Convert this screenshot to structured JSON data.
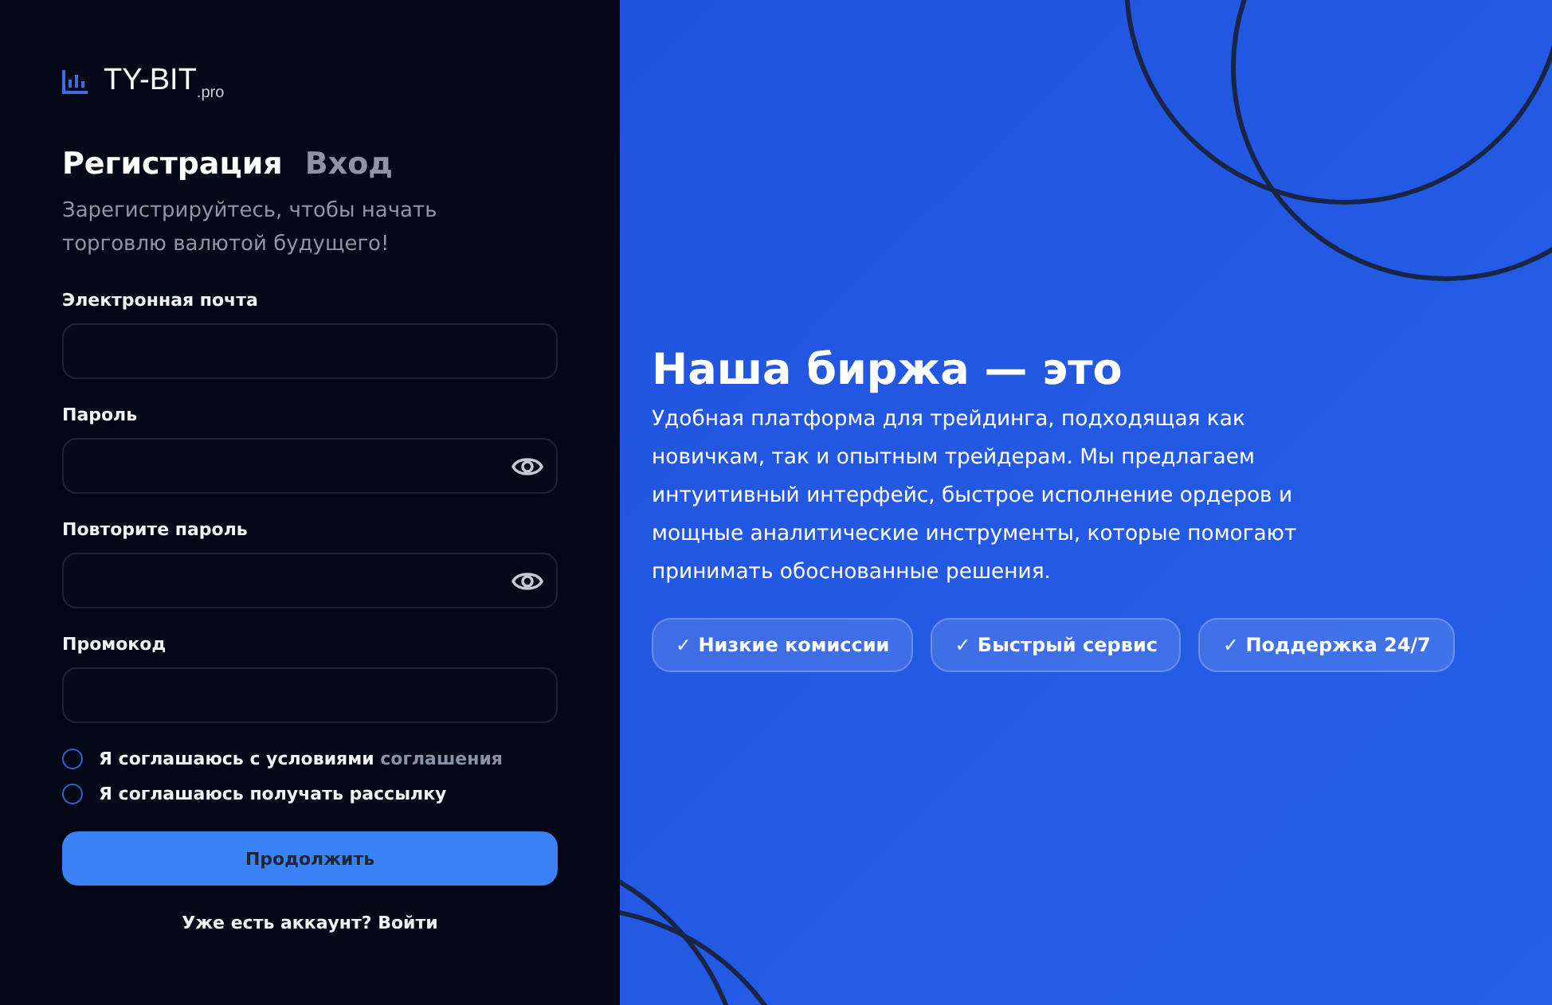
{
  "logo": {
    "name": "TY-BIT",
    "suffix": ".pro"
  },
  "tabs": [
    {
      "label": "Регистрация",
      "selected": true
    },
    {
      "label": "Вход",
      "selected": false
    }
  ],
  "subtitle": "Зарегистрируйтесь, чтобы начать торговлю валютой будущего!",
  "fields": [
    {
      "label": "Электронная почта",
      "kind": "text"
    },
    {
      "label": "Пароль",
      "kind": "password"
    },
    {
      "label": "Повторите пароль",
      "kind": "password"
    },
    {
      "label": "Промокод",
      "kind": "text"
    }
  ],
  "agreements": [
    {
      "text": "Я соглашаюсь с условиями",
      "link": "соглашения",
      "checked": false
    },
    {
      "text": "Я соглашаюсь получать рассылку",
      "checked": false
    }
  ],
  "submit": "Продолжить",
  "login_prompt": "Уже есть аккаунт? Войти",
  "promo": {
    "title": "Наша биржа — это",
    "text": "Удобная платформа для трейдинга, подходящая как новичкам, так и опытным трейдерам. Мы предлагаем интуитивный интерфейс, быстрое исполнение ордеров и мощные аналитические инструменты, которые помогают принимать обоснованные решения.",
    "features": [
      "✓ Низкие комиссии",
      "✓ Быстрый сервис",
      "✓ Поддержка 24/7"
    ]
  }
}
